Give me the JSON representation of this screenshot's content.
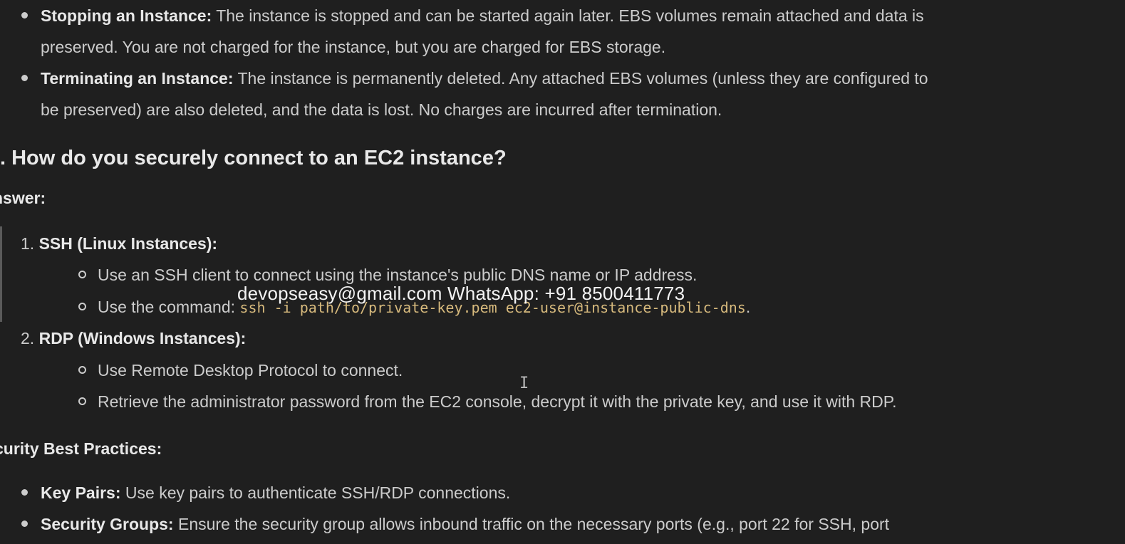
{
  "top_bullets": [
    {
      "term": "Stopping an Instance:",
      "line1": " The instance is stopped and can be started again later. EBS volumes remain attached and data is",
      "line2": "preserved. You are not charged for the instance, but you are charged for EBS storage."
    },
    {
      "term": "Terminating an Instance:",
      "line1": " The instance is permanently deleted. Any attached EBS volumes (unless they are configured to",
      "line2": "be preserved) are also deleted, and the data is lost. No charges are incurred after termination."
    }
  ],
  "question": {
    "heading": ". How do you securely connect to an EC2 instance?",
    "answer_label": "nswer:"
  },
  "methods": [
    {
      "number": "1.",
      "title": "SSH (Linux Instances):",
      "steps": [
        {
          "text": "Use an SSH client to connect using the instance's public DNS name or IP address."
        },
        {
          "text": "Use the command: ",
          "code": "ssh -i path/to/private-key.pem ec2-user@instance-public-dns",
          "suffix": "."
        }
      ]
    },
    {
      "number": "2.",
      "title": "RDP (Windows Instances):",
      "steps": [
        {
          "text": "Use Remote Desktop Protocol to connect."
        },
        {
          "text": "Retrieve the administrator password from the EC2 console, decrypt it with the private key, and use it with RDP."
        }
      ]
    }
  ],
  "watermark": "devopseasy@gmail.com WhatsApp: +91 8500411773",
  "cursor_glyph": "I",
  "security": {
    "label": "curity Best Practices:",
    "items": [
      {
        "term": "Key Pairs:",
        "text": " Use key pairs to authenticate SSH/RDP connections."
      },
      {
        "term": "Security Groups:",
        "text": " Ensure the security group allows inbound traffic on the necessary ports (e.g., port 22 for SSH, port"
      }
    ]
  },
  "colors": {
    "background": "#1f1f1f",
    "text": "#cccccc",
    "code": "#d7ba7d"
  }
}
